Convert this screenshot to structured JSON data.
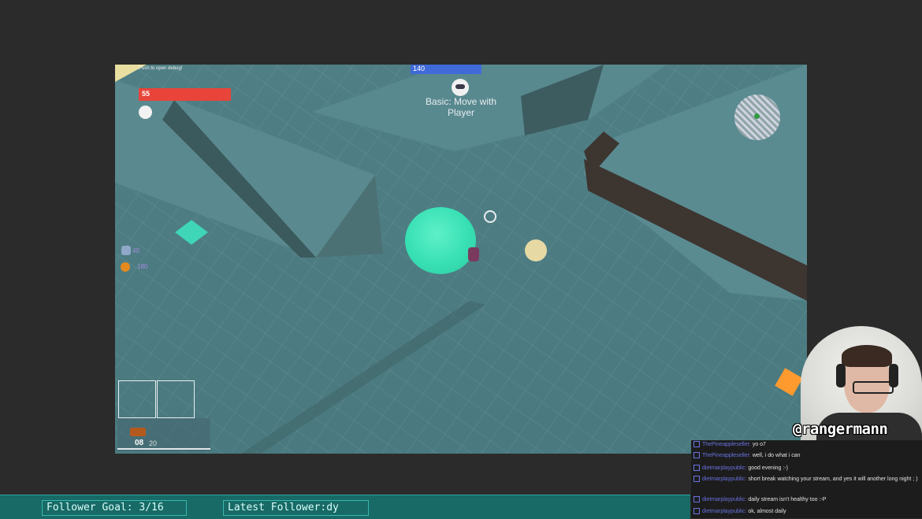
{
  "game": {
    "debug_hint": "Push to open debug!",
    "health_value": "55",
    "xp_value": "140",
    "ability_label": "Basic: Move with Player",
    "resource_1_value": "40",
    "resource_2_value": "180",
    "ammo_current": "08",
    "ammo_total": "20",
    "health_color": "#e8443a",
    "xp_color": "#3f6ad8",
    "shield_color": "#38e0b4"
  },
  "overlay": {
    "follower_goal": "Follower Goal: 3/16",
    "latest_follower": "Latest Follower:dy",
    "streamer_handle": "@rangermann"
  },
  "chat": [
    {
      "user": "ThePineappleseller:",
      "message": "yo o7"
    },
    {
      "user": "ThePineappleseller:",
      "message": "well, i do what i can"
    },
    {
      "user": "dietmarplaypublic:",
      "message": "good evening :-)"
    },
    {
      "user": "dietmarplaypublic:",
      "message": "short break watching your stream, and yes it will another long night ; )"
    },
    {
      "user": "dietmarplaypublic:",
      "message": "daily stream isn't healthy too :-P"
    },
    {
      "user": "dietmarplaypublic:",
      "message": "ok, almost daily"
    }
  ]
}
